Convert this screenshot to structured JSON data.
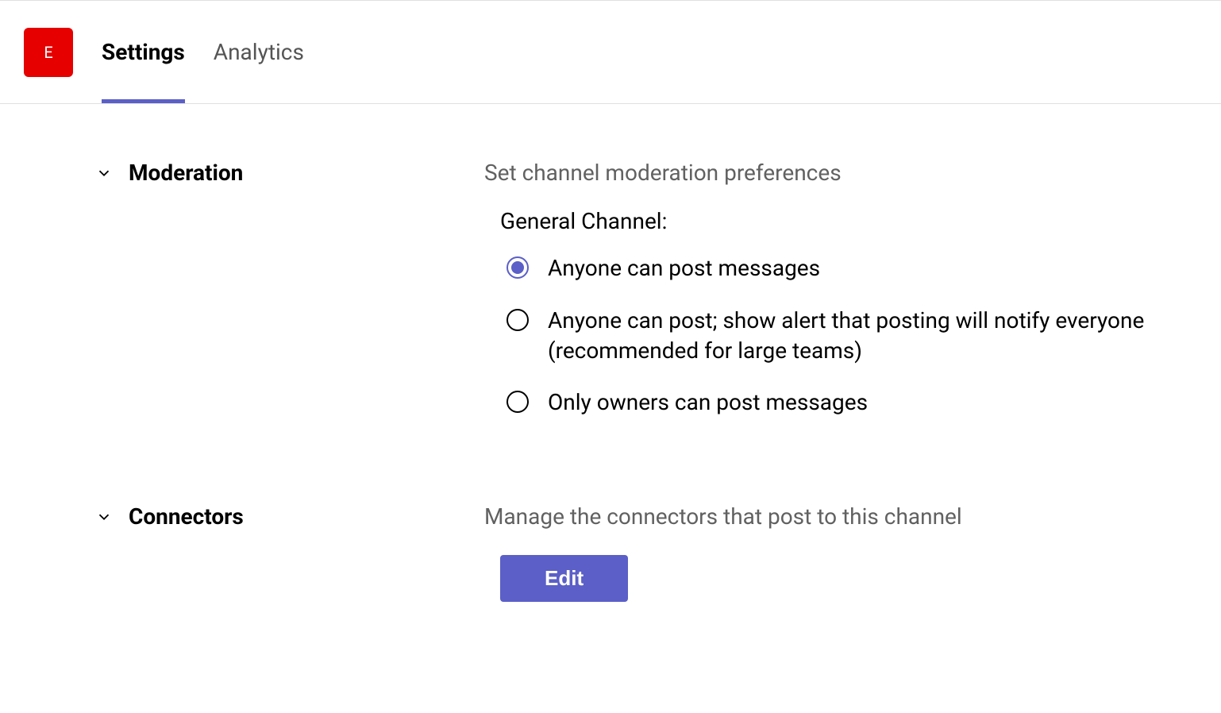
{
  "header": {
    "avatar_letter": "E",
    "tabs": [
      {
        "label": "Settings",
        "active": true
      },
      {
        "label": "Analytics",
        "active": false
      }
    ]
  },
  "sections": {
    "moderation": {
      "title": "Moderation",
      "description": "Set channel moderation preferences",
      "channel_label": "General Channel:",
      "options": [
        {
          "label": "Anyone can post messages",
          "checked": true
        },
        {
          "label": "Anyone can post; show alert that posting will notify everyone (recommended for large teams)",
          "checked": false
        },
        {
          "label": "Only owners can post messages",
          "checked": false
        }
      ]
    },
    "connectors": {
      "title": "Connectors",
      "description": "Manage the connectors that post to this channel",
      "button_label": "Edit"
    }
  }
}
